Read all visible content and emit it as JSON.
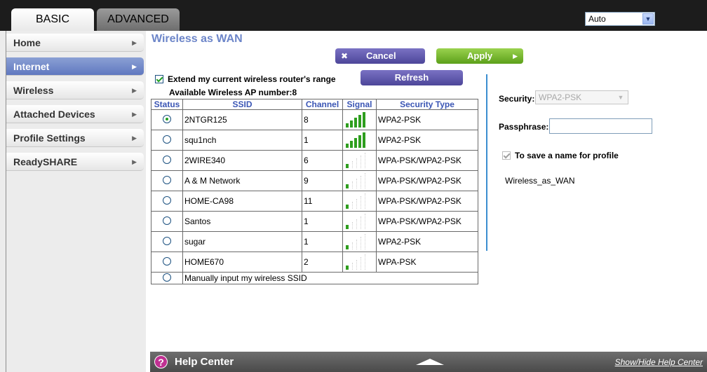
{
  "tabs": {
    "basic": "BASIC",
    "advanced": "ADVANCED"
  },
  "language": {
    "selected": "Auto"
  },
  "sidebar": {
    "items": [
      {
        "label": "Home",
        "active": false
      },
      {
        "label": "Internet",
        "active": true
      },
      {
        "label": "Wireless",
        "active": false
      },
      {
        "label": "Attached Devices",
        "active": false
      },
      {
        "label": "Profile Settings",
        "active": false
      },
      {
        "label": "ReadySHARE",
        "active": false
      }
    ]
  },
  "page": {
    "title": "Wireless as WAN",
    "cancel_label": "Cancel",
    "apply_label": "Apply",
    "refresh_label": "Refresh",
    "extend_label": "Extend my current wireless router's range",
    "ap_count_label": "Available Wireless AP number:8"
  },
  "table": {
    "headers": [
      "Status",
      "SSID",
      "Channel",
      "Signal",
      "Security Type"
    ],
    "rows": [
      {
        "ssid": "2NTGR125",
        "channel": "8",
        "signal_bars": 5,
        "security": "WPA2-PSK",
        "selected": true
      },
      {
        "ssid": "squ1nch",
        "channel": "1",
        "signal_bars": 5,
        "security": "WPA2-PSK",
        "selected": false
      },
      {
        "ssid": "2WIRE340",
        "channel": "6",
        "signal_bars": 1,
        "security": "WPA-PSK/WPA2-PSK",
        "selected": false
      },
      {
        "ssid": "A & M Network",
        "channel": "9",
        "signal_bars": 1,
        "security": "WPA-PSK/WPA2-PSK",
        "selected": false
      },
      {
        "ssid": "HOME-CA98",
        "channel": "11",
        "signal_bars": 1,
        "security": "WPA-PSK/WPA2-PSK",
        "selected": false
      },
      {
        "ssid": "Santos",
        "channel": "1",
        "signal_bars": 1,
        "security": "WPA-PSK/WPA2-PSK",
        "selected": false
      },
      {
        "ssid": "sugar",
        "channel": "1",
        "signal_bars": 1,
        "security": "WPA2-PSK",
        "selected": false
      },
      {
        "ssid": "HOME670",
        "channel": "2",
        "signal_bars": 1,
        "security": "WPA-PSK",
        "selected": false
      }
    ],
    "manual_label": "Manually input my wireless SSID"
  },
  "right": {
    "security_label": "Security:",
    "security_value": "WPA2-PSK",
    "passphrase_label": "Passphrase:",
    "passphrase_value": "",
    "save_label": "To save a name for profile",
    "profile_name": "Wireless_as_WAN"
  },
  "help": {
    "title": "Help Center",
    "toggle": "Show/Hide Help Center"
  },
  "colors": {
    "accent": "#6d86c9",
    "active_nav": "#6078c0",
    "apply_green": "#5ca01a",
    "cancel_purple": "#4d4699",
    "signal_green": "#2e9e1e"
  }
}
